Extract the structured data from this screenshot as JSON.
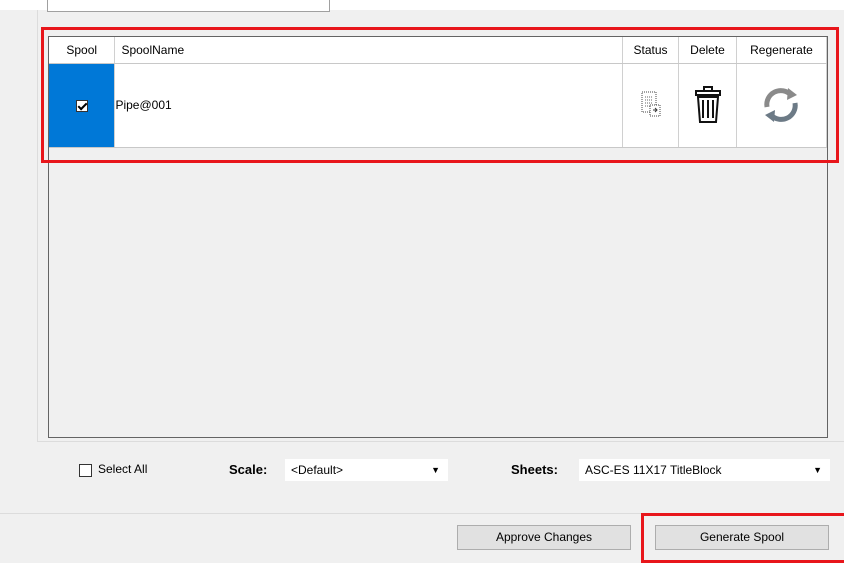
{
  "grid": {
    "columns": [
      "Spool",
      "SpoolName",
      "Status",
      "Delete",
      "Regenerate"
    ],
    "rows": [
      {
        "checked": true,
        "spool_name": "Pipe@001"
      }
    ]
  },
  "select_all_label": "Select All",
  "scale": {
    "label": "Scale:",
    "value": "<Default>"
  },
  "sheets": {
    "label": "Sheets:",
    "value": "ASC-ES 11X17 TitleBlock"
  },
  "buttons": {
    "approve": "Approve Changes",
    "generate": "Generate Spool"
  },
  "colors": {
    "selection": "#0078d7",
    "highlight": "#e8161b"
  },
  "icons": {
    "status": "document-status-icon",
    "delete": "trash-icon",
    "regenerate": "refresh-icon"
  }
}
